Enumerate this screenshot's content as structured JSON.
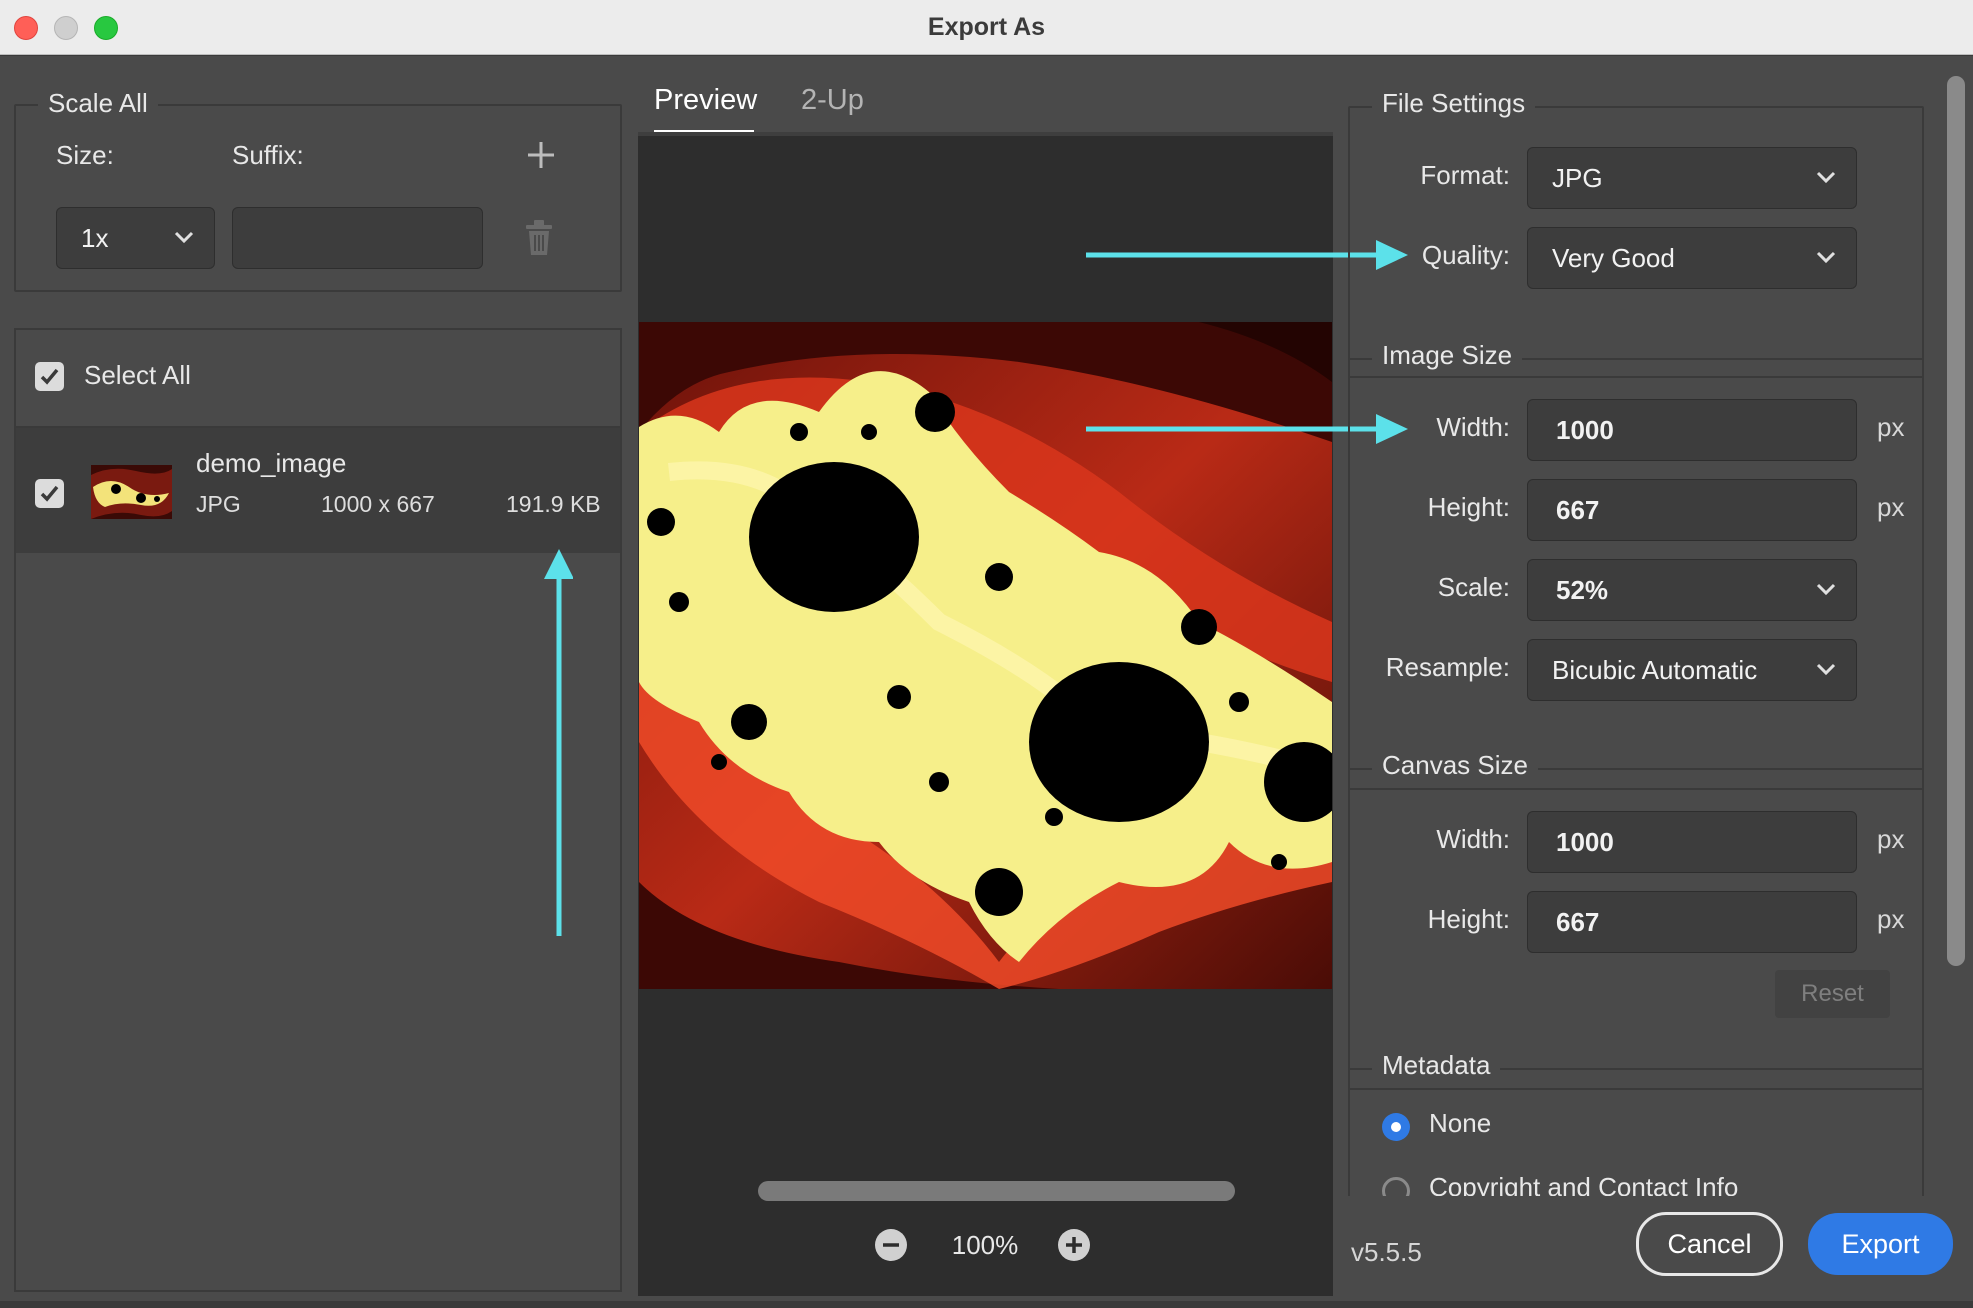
{
  "window": {
    "title": "Export As"
  },
  "scale_all": {
    "legend": "Scale All",
    "size_label": "Size:",
    "suffix_label": "Suffix:",
    "size_value": "1x",
    "suffix_value": "",
    "add_icon": "plus-icon",
    "delete_icon": "trash-icon"
  },
  "select_all": {
    "label": "Select All",
    "checked": true
  },
  "asset": {
    "name": "demo_image",
    "format": "JPG",
    "dimensions": "1000 x 667",
    "file_size": "191.9 KB",
    "checked": true
  },
  "preview": {
    "tabs": [
      {
        "label": "Preview",
        "active": true
      },
      {
        "label": "2-Up",
        "active": false
      }
    ],
    "zoom": "100%",
    "zoom_out_icon": "minus-circle-icon",
    "zoom_in_icon": "plus-circle-icon"
  },
  "file_settings": {
    "legend": "File Settings",
    "format_label": "Format:",
    "format_value": "JPG",
    "quality_label": "Quality:",
    "quality_value": "Very Good"
  },
  "image_size": {
    "legend": "Image Size",
    "width_label": "Width:",
    "width_value": "1000",
    "height_label": "Height:",
    "height_value": "667",
    "scale_label": "Scale:",
    "scale_value": "52%",
    "resample_label": "Resample:",
    "resample_value": "Bicubic Automatic",
    "unit": "px"
  },
  "canvas_size": {
    "legend": "Canvas Size",
    "width_label": "Width:",
    "width_value": "1000",
    "height_label": "Height:",
    "height_value": "667",
    "unit": "px",
    "reset_label": "Reset"
  },
  "metadata": {
    "legend": "Metadata",
    "options": [
      {
        "label": "None",
        "selected": true
      },
      {
        "label": "Copyright and Contact Info",
        "selected": false
      }
    ]
  },
  "footer": {
    "version": "v5.5.5",
    "cancel_label": "Cancel",
    "export_label": "Export"
  },
  "colors": {
    "accent": "#2f7ae5",
    "annotation_arrow": "#5ce1ea",
    "panel": "#4a4a4a",
    "canvas": "#2d2d2d"
  }
}
